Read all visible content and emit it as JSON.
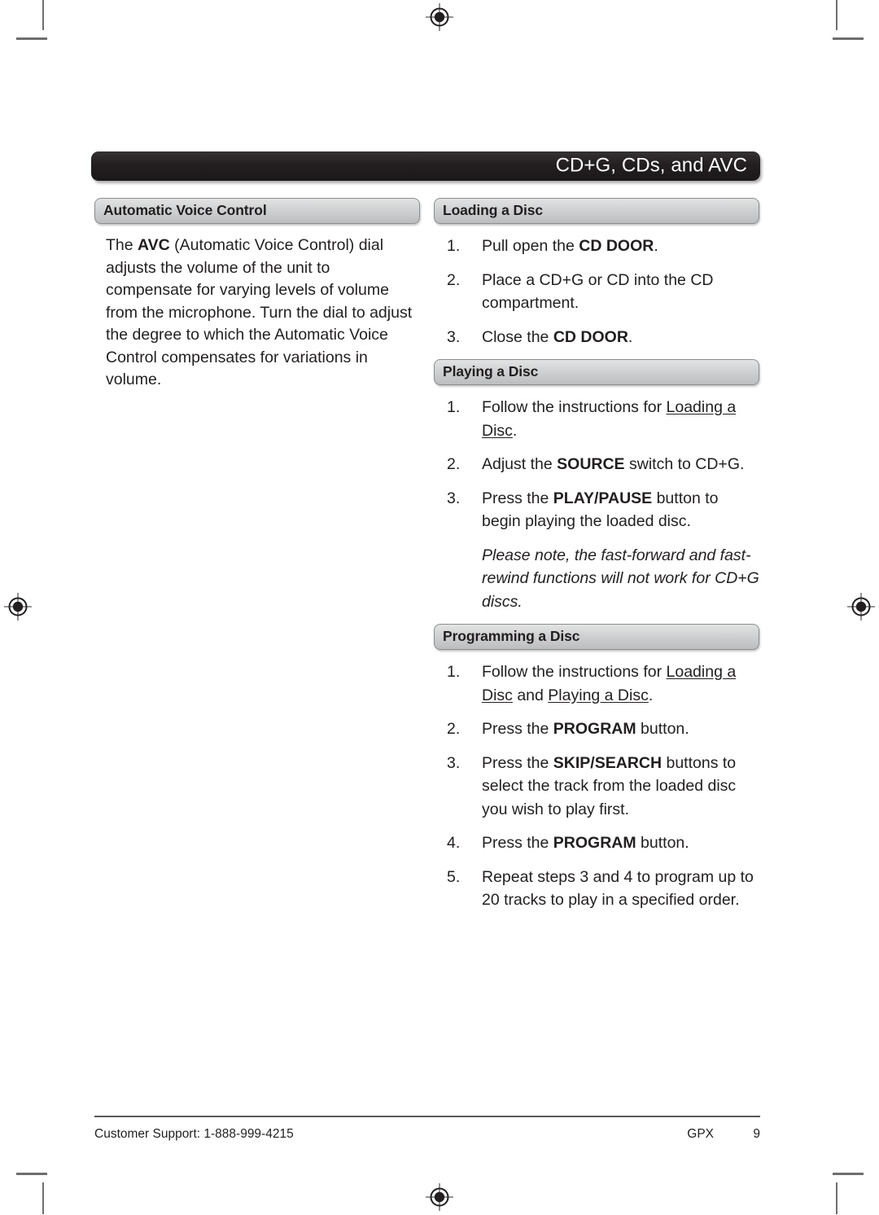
{
  "page": {
    "running_head": "CD+G, CDs, and AVC",
    "page_number": "9",
    "brand": "GPX",
    "customer_support": "Customer Support: 1-888-999-4215"
  },
  "colors": {
    "title_bar": "#231f20",
    "section_header_top": "#e3e3e4",
    "section_header_bottom": "#bcbdbf",
    "section_header_border": "#8b8d8f",
    "text": "#231f20",
    "rule": "#58595b",
    "crop_mark": "#6d6e70"
  },
  "left_column": {
    "sections": [
      {
        "heading": "Automatic Voice Control",
        "paragraph_html": "The <b>AVC</b> (Automatic Voice Control) dial adjusts the volume of the unit to compensate for varying levels of volume from the microphone. Turn the dial to adjust the degree to which the Automatic Voice Control compensates for variations in volume."
      }
    ]
  },
  "right_column": {
    "sections": [
      {
        "heading": "Loading a Disc",
        "steps": [
          {
            "num": "1.",
            "html": "Pull open the <b>CD DOOR</b>."
          },
          {
            "num": "2.",
            "html": "Place a CD+G or CD into the CD compartment."
          },
          {
            "num": "3.",
            "html": "Close the <b>CD DOOR</b>."
          }
        ]
      },
      {
        "heading": "Playing a Disc",
        "steps": [
          {
            "num": "1.",
            "html": "Follow the instructions for <span class=\"xref\">Loading a Disc</span>."
          },
          {
            "num": "2.",
            "html": "Adjust the <b>SOURCE</b> switch to CD+G."
          },
          {
            "num": "3.",
            "html": "Press the <b>PLAY/PAUSE</b> button to begin playing the loaded disc."
          }
        ],
        "note": "Please note, the fast-forward and fast-rewind functions will not work for CD+G discs."
      },
      {
        "heading": "Programming a Disc",
        "steps": [
          {
            "num": "1.",
            "html": "Follow the instructions for <span class=\"xref\">Loading a Disc</span> and <span class=\"xref\">Playing a Disc</span>."
          },
          {
            "num": "2.",
            "html": "Press the <b>PROGRAM</b> button."
          },
          {
            "num": "3.",
            "html": "Press the <b>SKIP/SEARCH</b> buttons to select the track from the loaded disc you wish to play first."
          },
          {
            "num": "4.",
            "html": "Press the <b>PROGRAM</b> button."
          },
          {
            "num": "5.",
            "html": "Repeat steps 3 and 4 to program up to 20 tracks to play in a specified order."
          }
        ]
      }
    ]
  },
  "print_marks": {
    "registration_marks": [
      "top-center",
      "left-middle",
      "right-middle",
      "bottom-center"
    ],
    "crop_marks": [
      "top-left",
      "top-right",
      "bottom-left",
      "bottom-right"
    ]
  }
}
